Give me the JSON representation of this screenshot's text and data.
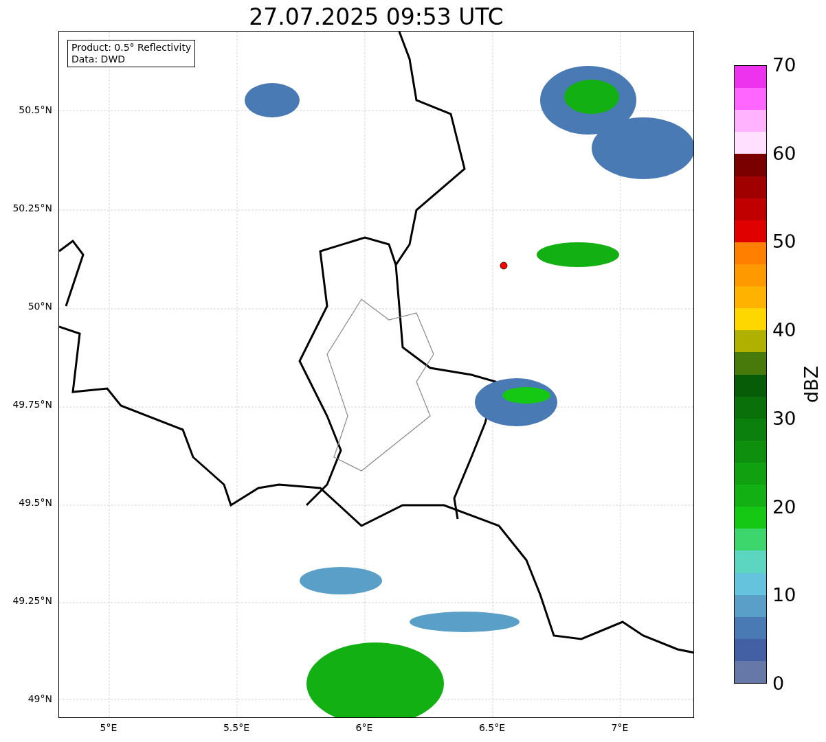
{
  "title": "27.07.2025 09:53 UTC",
  "legend": {
    "lines": [
      "Product: 0.5° Reflectivity",
      "Data: DWD"
    ]
  },
  "map": {
    "lat_ticks": [
      "50.5°N",
      "50.25°N",
      "50°N",
      "49.75°N",
      "49.5°N",
      "49.25°N",
      "49°N"
    ],
    "lon_ticks": [
      "5°E",
      "5.5°E",
      "6°E",
      "6.5°E",
      "7°E"
    ]
  },
  "colorbar": {
    "label": "dBZ",
    "ticks": [
      "70",
      "60",
      "50",
      "40",
      "30",
      "20",
      "10",
      "0"
    ],
    "segments": [
      {
        "color": "#ee33ee"
      },
      {
        "color": "#ff66ff"
      },
      {
        "color": "#ffb3ff"
      },
      {
        "color": "#ffe0ff"
      },
      {
        "color": "#7a0000"
      },
      {
        "color": "#a00000"
      },
      {
        "color": "#c00000"
      },
      {
        "color": "#e00000"
      },
      {
        "color": "#ff7f00"
      },
      {
        "color": "#ff9900"
      },
      {
        "color": "#ffb300"
      },
      {
        "color": "#ffd700"
      },
      {
        "color": "#b0b000"
      },
      {
        "color": "#477a0a"
      },
      {
        "color": "#075c07"
      },
      {
        "color": "#0a700a"
      },
      {
        "color": "#0c800c"
      },
      {
        "color": "#0e900e"
      },
      {
        "color": "#10a010"
      },
      {
        "color": "#12b012"
      },
      {
        "color": "#14c814"
      },
      {
        "color": "#3cd66c"
      },
      {
        "color": "#5cd6c0"
      },
      {
        "color": "#66c3dd"
      },
      {
        "color": "#5a9fc8"
      },
      {
        "color": "#4a7ab4"
      },
      {
        "color": "#4460a4"
      },
      {
        "color": "#6678a8"
      }
    ]
  }
}
